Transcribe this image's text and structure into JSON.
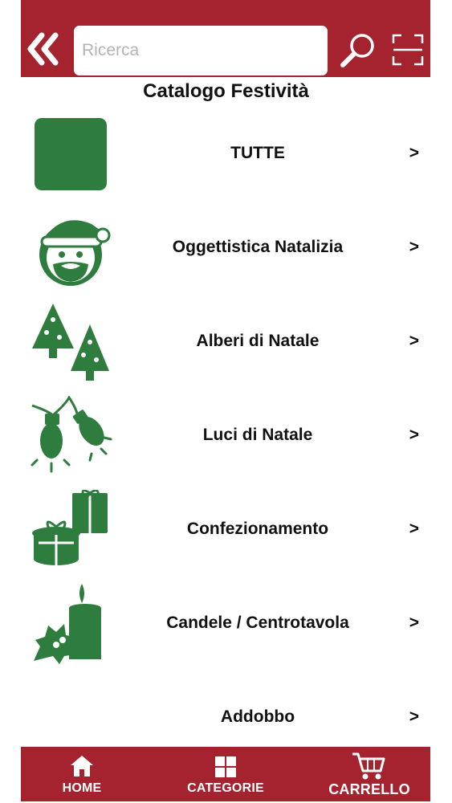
{
  "header": {
    "search_placeholder": "Ricerca",
    "search_value": ""
  },
  "page": {
    "title": "Catalogo Festività"
  },
  "catalog": {
    "items": [
      {
        "label": "TUTTE",
        "chevron": ">",
        "icon": "green-square-icon"
      },
      {
        "label": "Oggettistica Natalizia",
        "chevron": ">",
        "icon": "santa-icon"
      },
      {
        "label": "Alberi di Natale",
        "chevron": ">",
        "icon": "christmas-trees-icon"
      },
      {
        "label": "Luci di Natale",
        "chevron": ">",
        "icon": "christmas-lights-icon"
      },
      {
        "label": "Confezionamento",
        "chevron": ">",
        "icon": "gift-boxes-icon"
      },
      {
        "label": "Candele / Centrotavola",
        "chevron": ">",
        "icon": "candle-holly-icon"
      },
      {
        "label": "Addobbo",
        "chevron": ">",
        "icon": ""
      }
    ]
  },
  "bottom_nav": {
    "home": "HOME",
    "categories": "CATEGORIE",
    "cart": "CARRELLO"
  },
  "colors": {
    "bar": "#a5222f",
    "icon_green": "#2e7d3e"
  }
}
